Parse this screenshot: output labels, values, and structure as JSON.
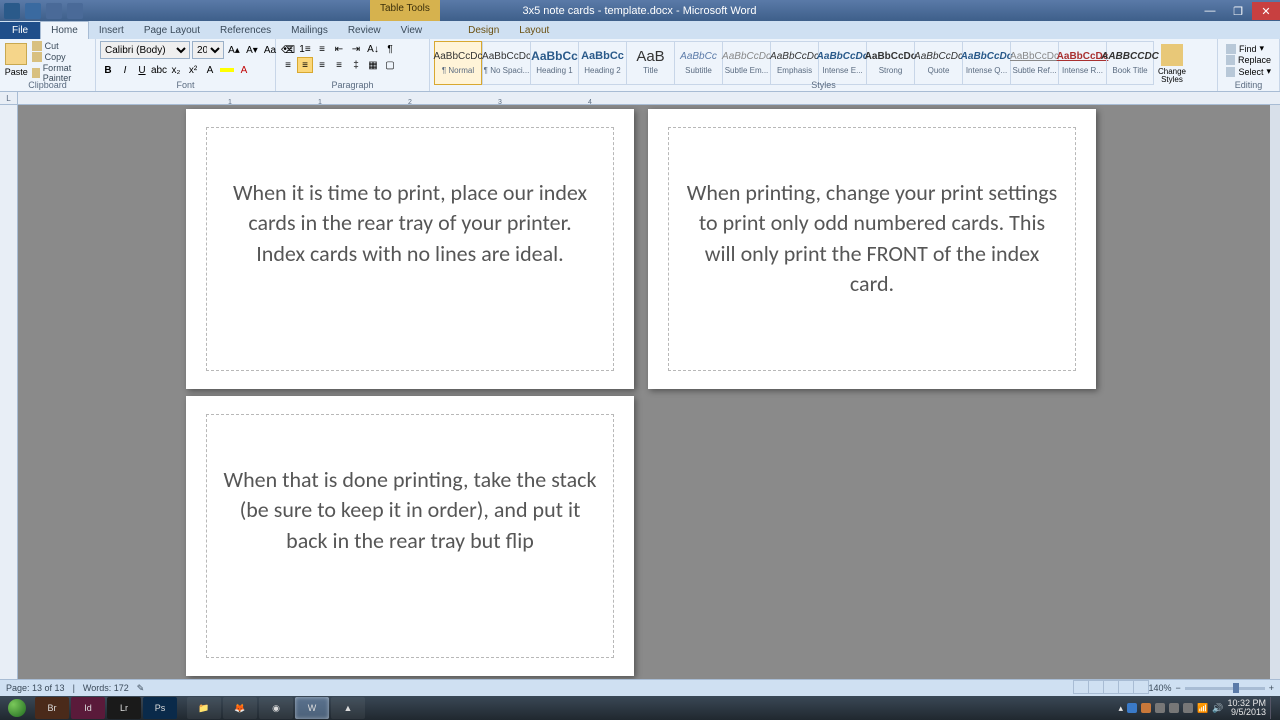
{
  "title": "3x5 note cards - template.docx - Microsoft Word",
  "contextTab": "Table Tools",
  "tabs": {
    "file": "File",
    "home": "Home",
    "insert": "Insert",
    "pagelayout": "Page Layout",
    "references": "References",
    "mailings": "Mailings",
    "review": "Review",
    "view": "View",
    "design": "Design",
    "layout": "Layout"
  },
  "ribbon": {
    "clipboard": {
      "label": "Clipboard",
      "paste": "Paste",
      "cut": "Cut",
      "copy": "Copy",
      "fmt": "Format Painter"
    },
    "font": {
      "label": "Font",
      "name": "Calibri (Body)",
      "size": "20"
    },
    "paragraph": {
      "label": "Paragraph"
    },
    "styles": {
      "label": "Styles",
      "items": [
        {
          "preview": "AaBbCcDc",
          "name": "¶ Normal",
          "sel": true,
          "color": "#333"
        },
        {
          "preview": "AaBbCcDc",
          "name": "¶ No Spaci...",
          "color": "#333"
        },
        {
          "preview": "AaBbCc",
          "name": "Heading 1",
          "color": "#2a5a8a",
          "size": "12px",
          "bold": true
        },
        {
          "preview": "AaBbCc",
          "name": "Heading 2",
          "color": "#2a5a8a",
          "size": "11px",
          "bold": true
        },
        {
          "preview": "AaB",
          "name": "Title",
          "color": "#333",
          "size": "15px"
        },
        {
          "preview": "AaBbCc",
          "name": "Subtitle",
          "color": "#5a7aa8",
          "italic": true
        },
        {
          "preview": "AaBbCcDc",
          "name": "Subtle Em...",
          "color": "#888",
          "italic": true
        },
        {
          "preview": "AaBbCcDc",
          "name": "Emphasis",
          "color": "#333",
          "italic": true
        },
        {
          "preview": "AaBbCcDc",
          "name": "Intense E...",
          "color": "#2a5a8a",
          "italic": true,
          "bold": true
        },
        {
          "preview": "AaBbCcDc",
          "name": "Strong",
          "color": "#333",
          "bold": true
        },
        {
          "preview": "AaBbCcDc",
          "name": "Quote",
          "color": "#333",
          "italic": true
        },
        {
          "preview": "AaBbCcDc",
          "name": "Intense Q...",
          "color": "#2a5a8a",
          "italic": true,
          "bold": true
        },
        {
          "preview": "AaBbCcDc",
          "name": "Subtle Ref...",
          "color": "#888",
          "ul": true
        },
        {
          "preview": "AaBbCcDc",
          "name": "Intense R...",
          "color": "#a83030",
          "ul": true,
          "bold": true
        },
        {
          "preview": "AABBCCDC",
          "name": "Book Title",
          "color": "#333",
          "bold": true,
          "italic": true
        }
      ],
      "change": "Change Styles"
    },
    "editing": {
      "label": "Editing",
      "find": "Find",
      "replace": "Replace",
      "select": "Select"
    }
  },
  "cards": {
    "c1": "When it is time to print, place our index cards in the rear tray of your printer.  Index cards with no lines are ideal.",
    "c2": "When printing, change your print settings to print only odd numbered cards.  This will only print the FRONT of the index card.",
    "c3": "When that is done printing, take the stack (be sure to keep it in order), and put it back in the rear tray but flip"
  },
  "status": {
    "page": "Page: 13 of 13",
    "words": "Words: 172",
    "zoom": "140%"
  },
  "taskbar": {
    "time": "10:32 PM",
    "date": "9/5/2013",
    "apps": [
      "Br",
      "Id",
      "Lr",
      "Ps"
    ]
  }
}
